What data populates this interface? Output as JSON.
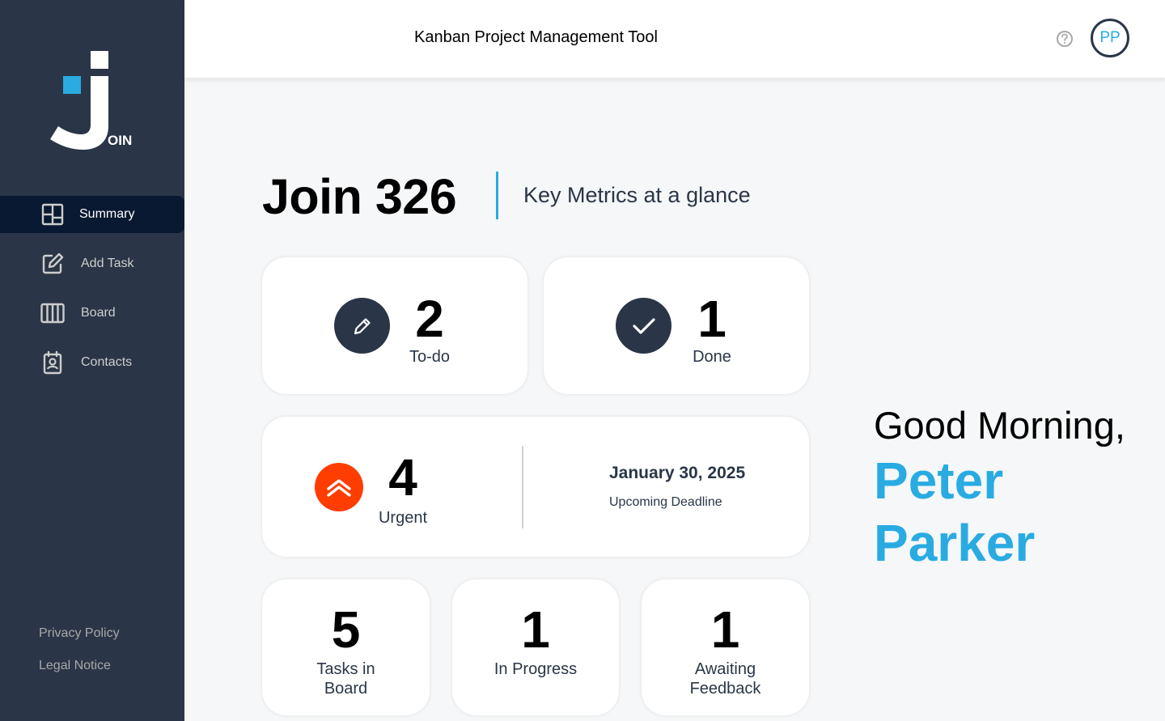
{
  "app": {
    "logo_text": "OIN"
  },
  "sidebar": {
    "items": [
      {
        "label": "Summary",
        "icon": "summary-icon",
        "active": true
      },
      {
        "label": "Add Task",
        "icon": "add-task-icon"
      },
      {
        "label": "Board",
        "icon": "board-icon"
      },
      {
        "label": "Contacts",
        "icon": "contacts-icon"
      }
    ],
    "footer": [
      {
        "label": "Privacy Policy"
      },
      {
        "label": "Legal Notice"
      }
    ]
  },
  "header": {
    "title": "Kanban Project Management Tool",
    "help_icon": "help-icon",
    "avatar_initials": "PP"
  },
  "summary": {
    "title": "Join 326",
    "subtitle": "Key Metrics at a glance",
    "todo": {
      "count": "2",
      "label": "To-do",
      "icon": "pencil-icon"
    },
    "done": {
      "count": "1",
      "label": "Done",
      "icon": "check-icon"
    },
    "urgent": {
      "count": "4",
      "label": "Urgent",
      "icon": "urgent-icon"
    },
    "deadline": {
      "date": "January 30, 2025",
      "label": "Upcoming Deadline"
    },
    "tasks_in_board": {
      "count": "5",
      "label_line1": "Tasks in",
      "label_line2": "Board"
    },
    "in_progress": {
      "count": "1",
      "label": "In Progress"
    },
    "awaiting_feedback": {
      "count": "1",
      "label_line1": "Awaiting",
      "label_line2": "Feedback"
    }
  },
  "greeting": {
    "text": "Good Morning,",
    "first_name": "Peter",
    "last_name": "Parker"
  },
  "colors": {
    "sidebar_bg": "#2A3647",
    "active_item_bg": "#091931",
    "accent": "#29ABE2",
    "urgent": "#FF3D00"
  }
}
